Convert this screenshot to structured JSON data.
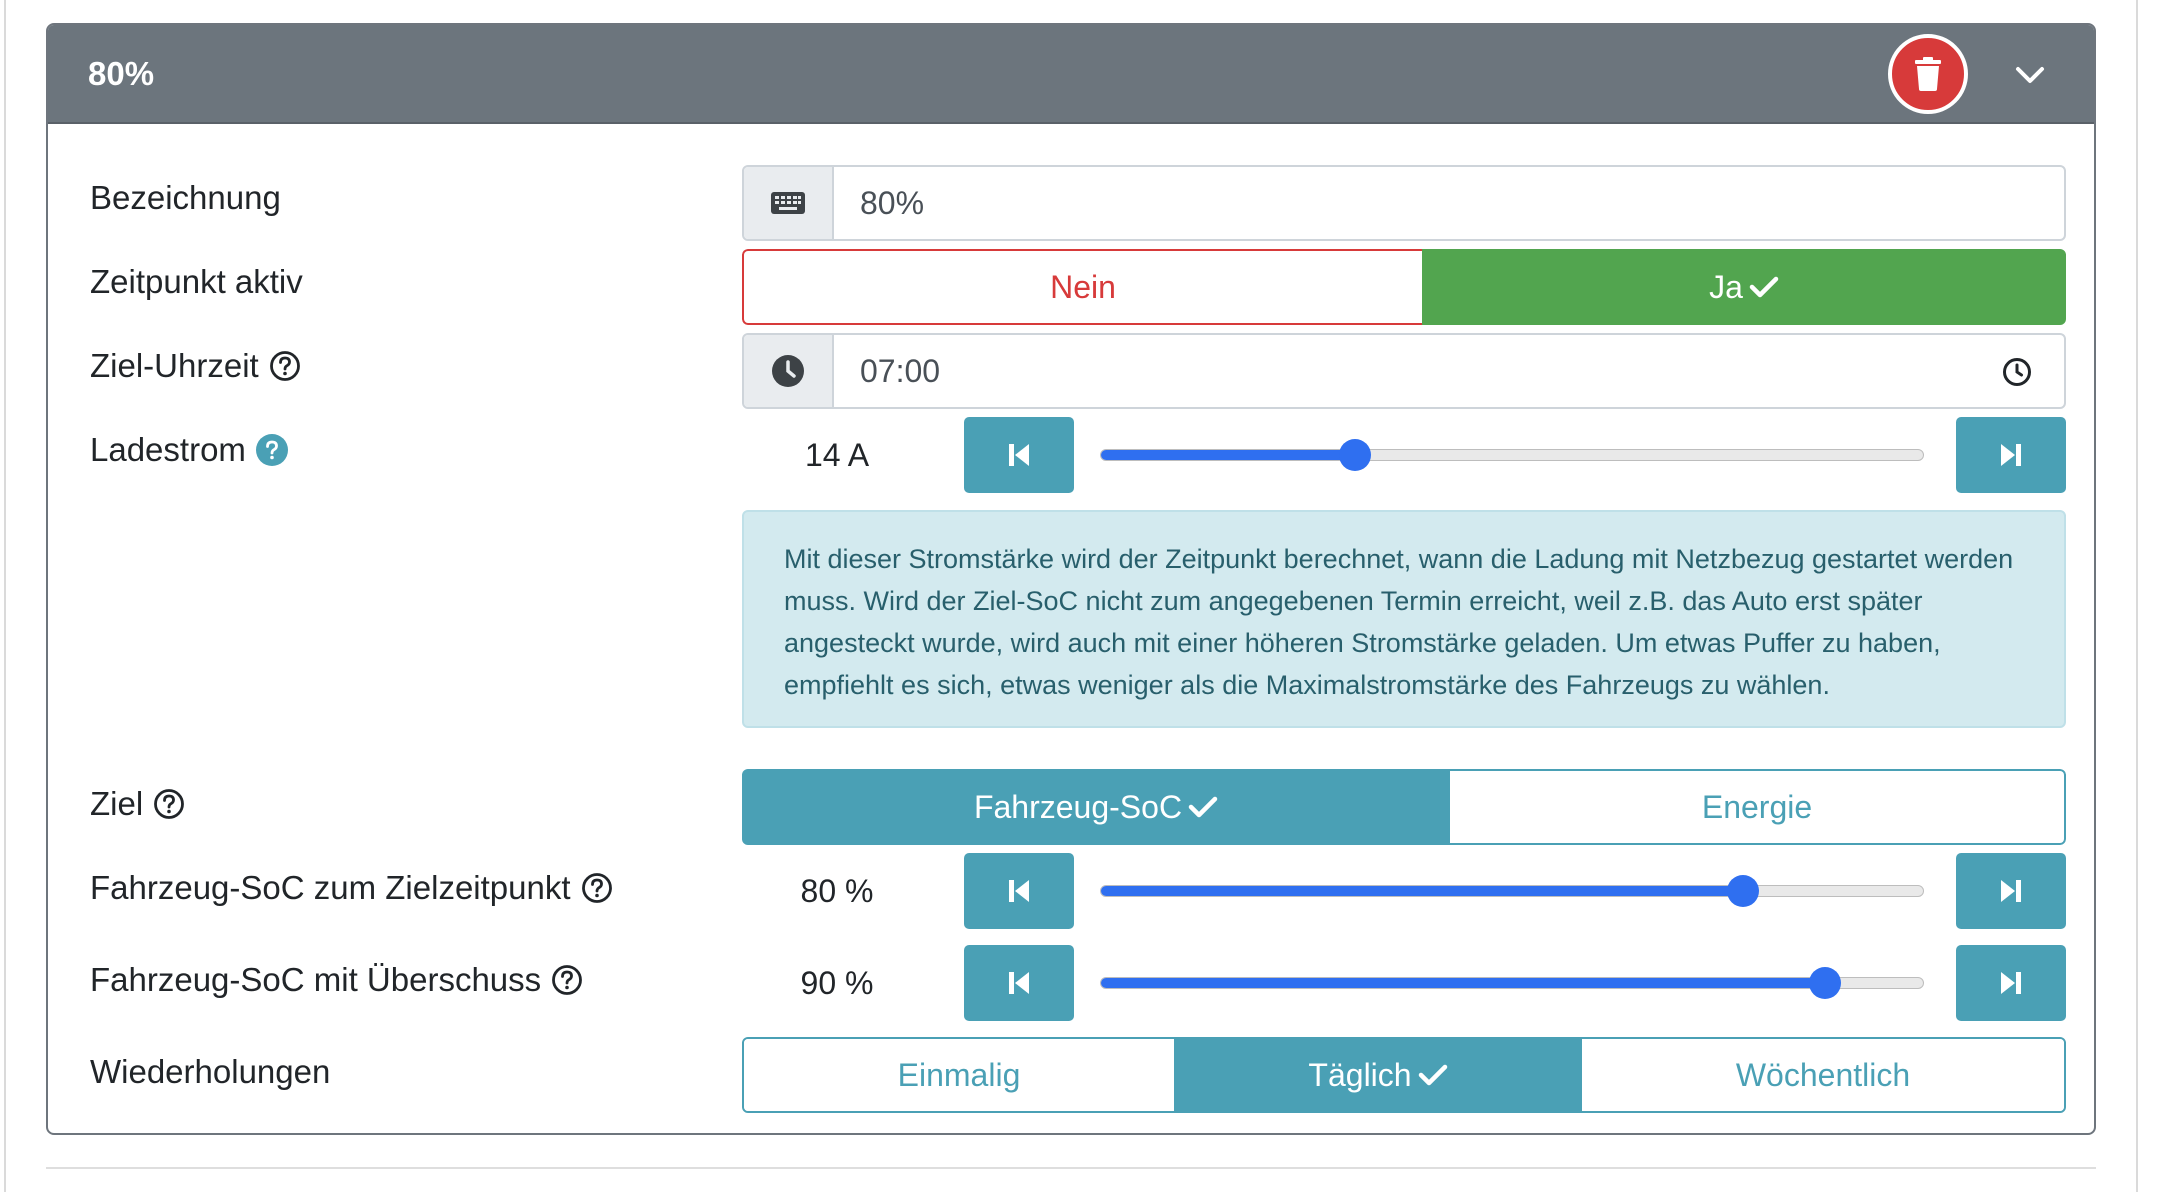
{
  "card": {
    "title": "80%"
  },
  "fields": {
    "bezeichnung": {
      "label": "Bezeichnung",
      "value": "80%",
      "prepend_icon": "keyboard-icon"
    },
    "zeitpunkt_aktiv": {
      "label": "Zeitpunkt aktiv",
      "options": [
        {
          "label": "Nein",
          "selected": false
        },
        {
          "label": "Ja",
          "selected": true
        }
      ]
    },
    "ziel_uhrzeit": {
      "label": "Ziel-Uhrzeit",
      "value": "07:00",
      "prepend_icon": "clock-icon"
    },
    "ladestrom": {
      "label": "Ladestrom",
      "value_text": "14 A",
      "fraction": 0.31,
      "help_text": "Mit dieser Stromstärke wird der Zeitpunkt berechnet, wann die Ladung mit Netzbezug gestartet werden muss. Wird der Ziel-SoC nicht zum angegebenen Termin erreicht, weil z.B. das Auto erst später angesteckt wurde, wird auch mit einer höheren Stromstärke geladen. Um etwas Puffer zu haben, empfiehlt es sich, etwas weniger als die Maximalstromstärke des Fahrzeugs zu wählen."
    },
    "ziel": {
      "label": "Ziel",
      "options": [
        {
          "label": "Fahrzeug-SoC",
          "selected": true
        },
        {
          "label": "Energie",
          "selected": false
        }
      ]
    },
    "soc_zielzeitpunkt": {
      "label": "Fahrzeug-SoC zum Zielzeitpunkt",
      "value_text": "80 %",
      "fraction": 0.78
    },
    "soc_ueberschuss": {
      "label": "Fahrzeug-SoC mit Überschuss",
      "value_text": "90 %",
      "fraction": 0.88
    },
    "wiederholungen": {
      "label": "Wiederholungen",
      "options": [
        {
          "label": "Einmalig",
          "selected": false
        },
        {
          "label": "Täglich",
          "selected": true
        },
        {
          "label": "Wöchentlich",
          "selected": false
        }
      ]
    }
  },
  "colors": {
    "header_bg": "#6c757d",
    "danger": "#d73a3a",
    "success": "#52a54f",
    "info": "#4aa0b5",
    "slider": "#2f6ff0",
    "info_box_bg": "#d3eaef",
    "info_box_text": "#285f6c"
  }
}
